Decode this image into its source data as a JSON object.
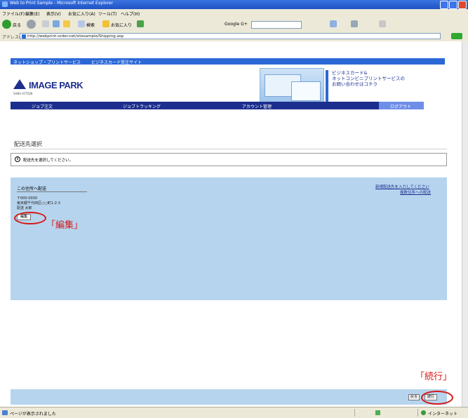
{
  "window": {
    "title": "Web to Print Sample - Microsoft Internet Explorer"
  },
  "menubar": {
    "items": [
      "ファイル(F)",
      "編集(E)",
      "表示(V)",
      "お気に入り(A)",
      "ツール(T)",
      "ヘルプ(H)"
    ]
  },
  "toolbar": {
    "back_label": "戻る",
    "search_label": "検索",
    "favorites_label": "お気に入り",
    "go_label": "Google G+"
  },
  "addressbar": {
    "label": "アドレス(D)",
    "url": "http://webprint-order.net/sitesample/Shipping.asp"
  },
  "site": {
    "top_links": [
      "ネットショップ・プリントサービス",
      "ビジネスカード受注サイト"
    ],
    "logo_text": "IMAGE PARK",
    "logo_sub": "SANS ACTION",
    "banner_lines": [
      "ビジネスカード&",
      "ネットコンビニプリントサービスの",
      "お問い合わせはコチラ"
    ],
    "nav": [
      "ジョブ注文",
      "ジョブトラッキング",
      "アカウント管理"
    ],
    "nav_mypage": "ログアウト"
  },
  "page": {
    "title": "配送先選択",
    "notice": "配送先を選択してください。"
  },
  "address_panel": {
    "heading": "この住所へ配送",
    "lines": [
      "〒000-0000",
      "東京都千代田区○○町1-2-3",
      "配送 太郎"
    ],
    "edit_label": "編集",
    "right_links": [
      "新規配送先を入力してください",
      "複数住所への配送"
    ]
  },
  "annotations": {
    "edit": "「編集」",
    "continue": "「続行」"
  },
  "footer": {
    "back_label": "戻る",
    "next_label": "続行"
  },
  "statusbar": {
    "text": "ページが表示されました",
    "zone": "インターネット"
  },
  "colors": {
    "site_blue": "#1c2f8e",
    "strip_blue": "#2b68d6",
    "panel_bg": "#b6d4ee",
    "annotation_red": "#d81818"
  }
}
